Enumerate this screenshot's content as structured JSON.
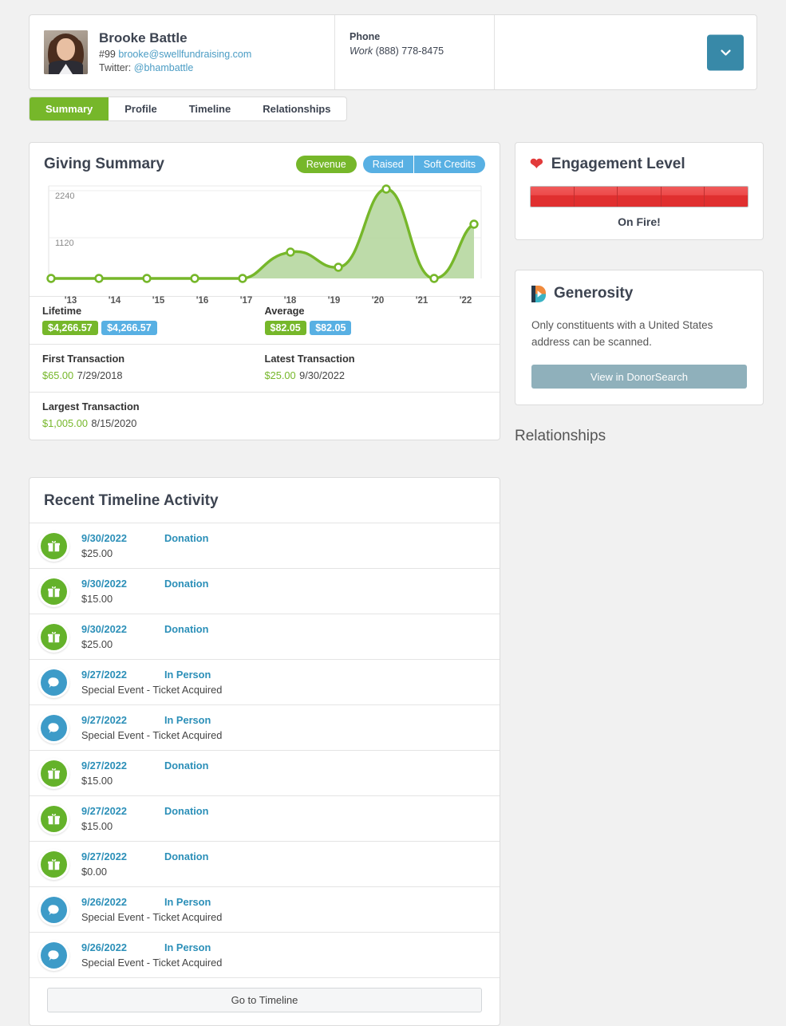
{
  "header": {
    "name": "Brooke Battle",
    "id_number": "#99",
    "email": "brooke@swellfundraising.com",
    "twitter_label": "Twitter:",
    "twitter_handle": "@bhambattle",
    "phone_label": "Phone",
    "phone_type": "Work",
    "phone_number": "(888) 778-8475",
    "dropdown_icon": "chevron-down-icon"
  },
  "tabs": [
    {
      "label": "Summary",
      "active": true
    },
    {
      "label": "Profile",
      "active": false
    },
    {
      "label": "Timeline",
      "active": false
    },
    {
      "label": "Relationships",
      "active": false
    }
  ],
  "giving": {
    "title": "Giving Summary",
    "toggle_revenue": "Revenue",
    "toggle_raised": "Raised",
    "toggle_soft_credits": "Soft Credits",
    "stats": [
      {
        "left_label": "Lifetime",
        "left_badges": [
          "$4,266.57",
          "$4,266.57"
        ],
        "right_label": "Average",
        "right_badges": [
          "$82.05",
          "$82.05"
        ]
      },
      {
        "left_label": "First Transaction",
        "left_amount": "$65.00",
        "left_date": "7/29/2018",
        "right_label": "Latest Transaction",
        "right_amount": "$25.00",
        "right_date": "9/30/2022"
      },
      {
        "left_label": "Largest Transaction",
        "left_amount": "$1,005.00",
        "left_date": "8/15/2020",
        "right_label": "",
        "right_amount": "",
        "right_date": ""
      }
    ]
  },
  "chart_data": {
    "type": "area",
    "title": "Giving Summary",
    "categories": [
      "'13",
      "'14",
      "'15",
      "'16",
      "'17",
      "'18",
      "'19",
      "'20",
      "'21",
      "'22"
    ],
    "values": [
      0,
      0,
      0,
      0,
      0,
      620,
      210,
      2360,
      0,
      1480
    ],
    "series": [
      {
        "name": "Revenue",
        "values": [
          0,
          0,
          0,
          0,
          0,
          620,
          210,
          2360,
          0,
          1480
        ]
      }
    ],
    "ytick_labels": [
      "1120",
      "2240"
    ],
    "yticks": [
      1120,
      2240
    ],
    "ylim": [
      0,
      2600
    ],
    "xlabel": "",
    "ylabel": "",
    "grid": true,
    "legend": [
      "Revenue",
      "Raised",
      "Soft Credits"
    ],
    "line_color": "#76b72a",
    "fill_color": "#b6d7a0"
  },
  "engagement": {
    "title": "Engagement Level",
    "icon": "heart-icon",
    "segments_total": 5,
    "segments_filled": 5,
    "status": "On Fire!",
    "color": "#e23b3b"
  },
  "generosity": {
    "title": "Generosity",
    "icon": "donorsearch-d-logo",
    "description": "Only constituents with a United States address can be scanned.",
    "button_label": "View in DonorSearch",
    "button_color": "#8fb0bb"
  },
  "relationships_heading": "Relationships",
  "timeline": {
    "title": "Recent Timeline Activity",
    "button_label": "Go to Timeline",
    "rows": [
      {
        "icon": "gift-icon",
        "kind": "gift",
        "date": "9/30/2022",
        "type": "Donation",
        "detail": "$25.00"
      },
      {
        "icon": "gift-icon",
        "kind": "gift",
        "date": "9/30/2022",
        "type": "Donation",
        "detail": "$15.00"
      },
      {
        "icon": "gift-icon",
        "kind": "gift",
        "date": "9/30/2022",
        "type": "Donation",
        "detail": "$25.00"
      },
      {
        "icon": "chat-bubble-icon",
        "kind": "chat",
        "date": "9/27/2022",
        "type": "In Person",
        "detail": "Special Event - Ticket Acquired"
      },
      {
        "icon": "chat-bubble-icon",
        "kind": "chat",
        "date": "9/27/2022",
        "type": "In Person",
        "detail": "Special Event - Ticket Acquired"
      },
      {
        "icon": "gift-icon",
        "kind": "gift",
        "date": "9/27/2022",
        "type": "Donation",
        "detail": "$15.00"
      },
      {
        "icon": "gift-icon",
        "kind": "gift",
        "date": "9/27/2022",
        "type": "Donation",
        "detail": "$15.00"
      },
      {
        "icon": "gift-icon",
        "kind": "gift",
        "date": "9/27/2022",
        "type": "Donation",
        "detail": "$0.00"
      },
      {
        "icon": "chat-bubble-icon",
        "kind": "chat",
        "date": "9/26/2022",
        "type": "In Person",
        "detail": "Special Event - Ticket Acquired"
      },
      {
        "icon": "chat-bubble-icon",
        "kind": "chat",
        "date": "9/26/2022",
        "type": "In Person",
        "detail": "Special Event - Ticket Acquired"
      }
    ]
  }
}
